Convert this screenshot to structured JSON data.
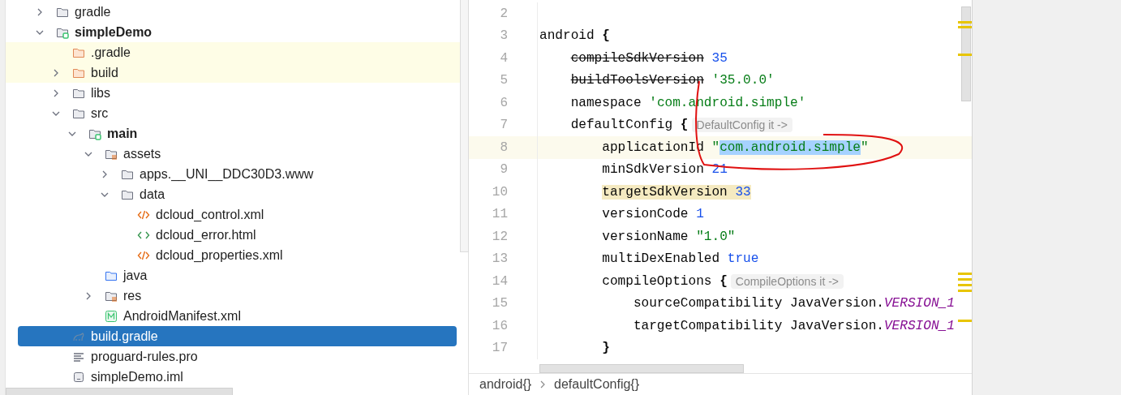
{
  "project_tree": {
    "items": [
      {
        "label": "gradle",
        "kind": "folder",
        "expanded": false,
        "selected": false,
        "highlighted": false
      },
      {
        "label": "simpleDemo",
        "kind": "module",
        "expanded": true,
        "selected": false,
        "highlighted": false,
        "children": [
          {
            "label": ".gradle",
            "kind": "excluded-folder",
            "selected": false,
            "highlighted": true
          },
          {
            "label": "build",
            "kind": "excluded-folder",
            "expanded": false,
            "selected": false,
            "highlighted": true
          },
          {
            "label": "libs",
            "kind": "folder",
            "expanded": false,
            "selected": false,
            "highlighted": false
          },
          {
            "label": "src",
            "kind": "folder",
            "expanded": true,
            "selected": false,
            "highlighted": false,
            "children": [
              {
                "label": "main",
                "kind": "module",
                "expanded": true,
                "selected": false,
                "highlighted": false,
                "children": [
                  {
                    "label": "assets",
                    "kind": "resource-folder",
                    "expanded": true,
                    "selected": false,
                    "highlighted": false,
                    "children": [
                      {
                        "label": "apps.__UNI__DDC30D3.www",
                        "kind": "folder",
                        "expanded": false,
                        "selected": false,
                        "highlighted": false
                      },
                      {
                        "label": "data",
                        "kind": "folder",
                        "expanded": true,
                        "selected": false,
                        "highlighted": false,
                        "children": [
                          {
                            "label": "dcloud_control.xml",
                            "kind": "xml",
                            "selected": false,
                            "highlighted": false
                          },
                          {
                            "label": "dcloud_error.html",
                            "kind": "html",
                            "selected": false,
                            "highlighted": false
                          },
                          {
                            "label": "dcloud_properties.xml",
                            "kind": "xml",
                            "selected": false,
                            "highlighted": false
                          }
                        ]
                      }
                    ]
                  },
                  {
                    "label": "java",
                    "kind": "source-folder",
                    "selected": false,
                    "highlighted": false
                  },
                  {
                    "label": "res",
                    "kind": "resource-folder",
                    "expanded": false,
                    "selected": false,
                    "highlighted": false
                  },
                  {
                    "label": "AndroidManifest.xml",
                    "kind": "manifest",
                    "selected": false,
                    "highlighted": false
                  }
                ]
              }
            ]
          },
          {
            "label": "build.gradle",
            "kind": "gradle",
            "selected": true,
            "highlighted": false
          },
          {
            "label": "proguard-rules.pro",
            "kind": "text",
            "selected": false,
            "highlighted": false
          },
          {
            "label": "simpleDemo.iml",
            "kind": "iml",
            "selected": false,
            "highlighted": false
          }
        ]
      }
    ]
  },
  "editor": {
    "lines": [
      {
        "number": "2",
        "current": false
      },
      {
        "number": "3",
        "current": false,
        "tokens": [
          {
            "text": "android ",
            "kind": "plain"
          },
          {
            "text": "{",
            "kind": "brace"
          }
        ],
        "children": [
          {
            "number": "4",
            "current": false,
            "tokens": [
              {
                "text": "compileSdkVersion",
                "kind": "deprecated"
              },
              {
                "text": " 35",
                "kind": "number"
              }
            ]
          },
          {
            "number": "5",
            "current": false,
            "tokens": [
              {
                "text": "buildToolsVersion",
                "kind": "deprecated"
              },
              {
                "text": " '35.0.0'",
                "kind": "string"
              }
            ]
          },
          {
            "number": "6",
            "current": false,
            "tokens": [
              {
                "text": "namespace ",
                "kind": "plain"
              },
              {
                "text": "'com.android.simple'",
                "kind": "string"
              }
            ]
          },
          {
            "number": "7",
            "current": false,
            "tokens": [
              {
                "text": "defaultConfig ",
                "kind": "plain"
              },
              {
                "text": "{",
                "kind": "brace"
              }
            ],
            "hint": "DefaultConfig it ->",
            "children": [
              {
                "number": "8",
                "current": true,
                "tokens": [
                  {
                    "text": "applicationId ",
                    "kind": "plain"
                  },
                  {
                    "text": "\"",
                    "kind": "string"
                  },
                  {
                    "text": "com.android.simple",
                    "kind": "string-selected"
                  },
                  {
                    "text": "\"",
                    "kind": "string"
                  }
                ]
              },
              {
                "number": "9",
                "current": false,
                "tokens": [
                  {
                    "text": "minSdkVersion ",
                    "kind": "plain"
                  },
                  {
                    "text": "21",
                    "kind": "number"
                  }
                ]
              },
              {
                "number": "10",
                "current": false,
                "tokens": [
                  {
                    "text": "targetSdkVersion ",
                    "kind": "plain-warning"
                  },
                  {
                    "text": "33",
                    "kind": "number-warning"
                  }
                ]
              },
              {
                "number": "11",
                "current": false,
                "tokens": [
                  {
                    "text": "versionCode ",
                    "kind": "plain"
                  },
                  {
                    "text": "1",
                    "kind": "number"
                  }
                ]
              },
              {
                "number": "12",
                "current": false,
                "tokens": [
                  {
                    "text": "versionName ",
                    "kind": "plain"
                  },
                  {
                    "text": "\"1.0\"",
                    "kind": "string"
                  }
                ]
              },
              {
                "number": "13",
                "current": false,
                "tokens": [
                  {
                    "text": "multiDexEnabled ",
                    "kind": "plain"
                  },
                  {
                    "text": "true",
                    "kind": "number"
                  }
                ]
              },
              {
                "number": "14",
                "current": false,
                "tokens": [
                  {
                    "text": "compileOptions ",
                    "kind": "plain"
                  },
                  {
                    "text": "{",
                    "kind": "brace"
                  }
                ],
                "hint": "CompileOptions it ->",
                "children": [
                  {
                    "number": "15",
                    "current": false,
                    "tokens": [
                      {
                        "text": "sourceCompatibility JavaVersion.",
                        "kind": "plain"
                      },
                      {
                        "text": "VERSION_1",
                        "kind": "constant"
                      }
                    ]
                  },
                  {
                    "number": "16",
                    "current": false,
                    "tokens": [
                      {
                        "text": "targetCompatibility JavaVersion.",
                        "kind": "plain"
                      },
                      {
                        "text": "VERSION_1",
                        "kind": "constant"
                      }
                    ]
                  }
                ]
              },
              {
                "number": "17",
                "current": false,
                "tokens": [
                  {
                    "text": "}",
                    "kind": "brace"
                  }
                ]
              }
            ]
          }
        ]
      }
    ]
  },
  "breadcrumbs": [
    {
      "label": "android{}"
    },
    {
      "label": "defaultConfig{}"
    }
  ]
}
